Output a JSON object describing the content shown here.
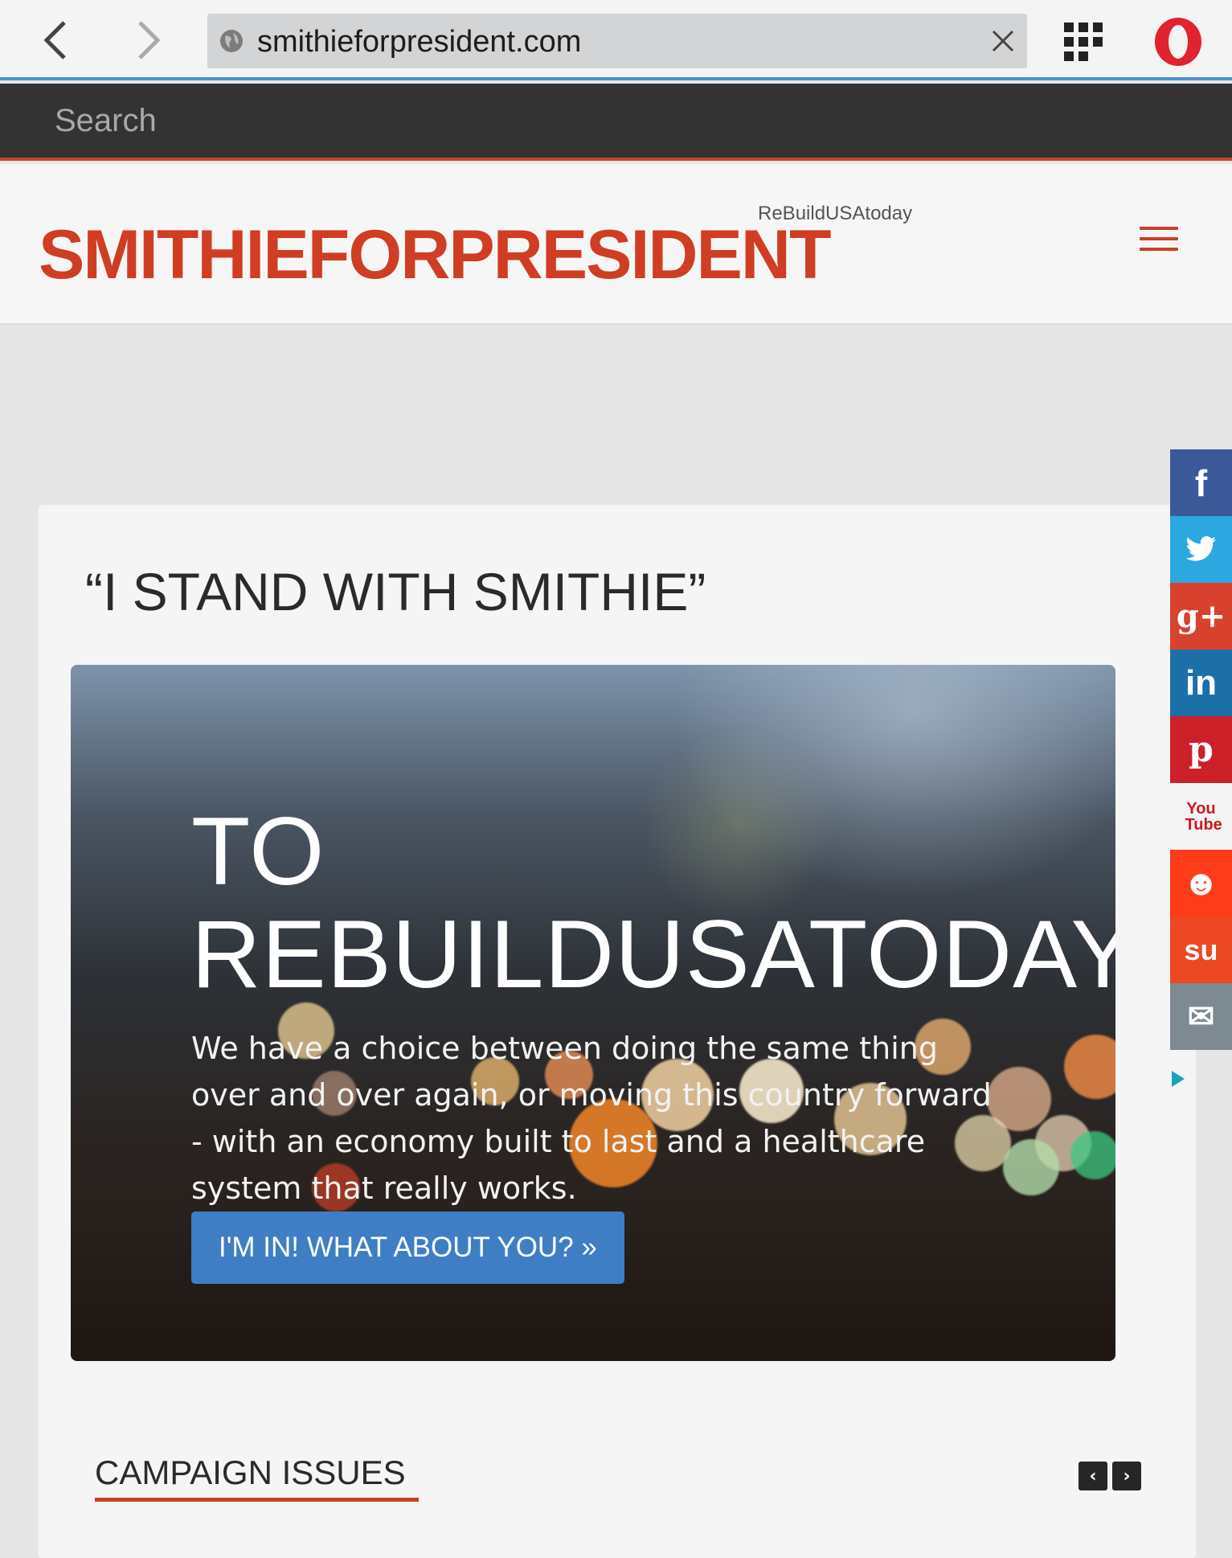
{
  "browser": {
    "url": "smithieforpresident.com"
  },
  "search": {
    "placeholder": "Search"
  },
  "site": {
    "logo": "SMITHIEFORPRESIDENT",
    "tagline": "ReBuildUSAtoday",
    "accent_color": "#cf3d25"
  },
  "main": {
    "quote_title": "“I STAND WITH SMITHIE”",
    "hero": {
      "title_line1": "TO",
      "title_line2": "REBUILDUSATODAY",
      "text": "We have a choice between doing the same thing over and over again, or moving this country forward - with an economy built to last and a healthcare system that really works.",
      "button_label": "I'M IN! WHAT ABOUT YOU? »",
      "button_color": "#3f7ec4"
    },
    "issues": {
      "title": "CAMPAIGN ISSUES",
      "prev_icon": "‹",
      "next_icon": "›"
    }
  },
  "social": {
    "items": [
      {
        "name": "facebook",
        "glyph": "f",
        "color": "#3b5998"
      },
      {
        "name": "twitter",
        "glyph": "🐦",
        "color": "#2ca7e0"
      },
      {
        "name": "google-plus",
        "glyph": "g+",
        "color": "#d9412f"
      },
      {
        "name": "linkedin",
        "glyph": "in",
        "color": "#1d6fa8"
      },
      {
        "name": "pinterest",
        "glyph": "p",
        "color": "#cd2029"
      },
      {
        "name": "youtube",
        "glyph": "You Tube",
        "color": "#f4f4f4"
      },
      {
        "name": "reddit",
        "glyph": "☻",
        "color": "#ff3c1a"
      },
      {
        "name": "stumbleupon",
        "glyph": "su",
        "color": "#eb4823"
      },
      {
        "name": "email",
        "glyph": "✉",
        "color": "#7d8a91"
      }
    ]
  }
}
